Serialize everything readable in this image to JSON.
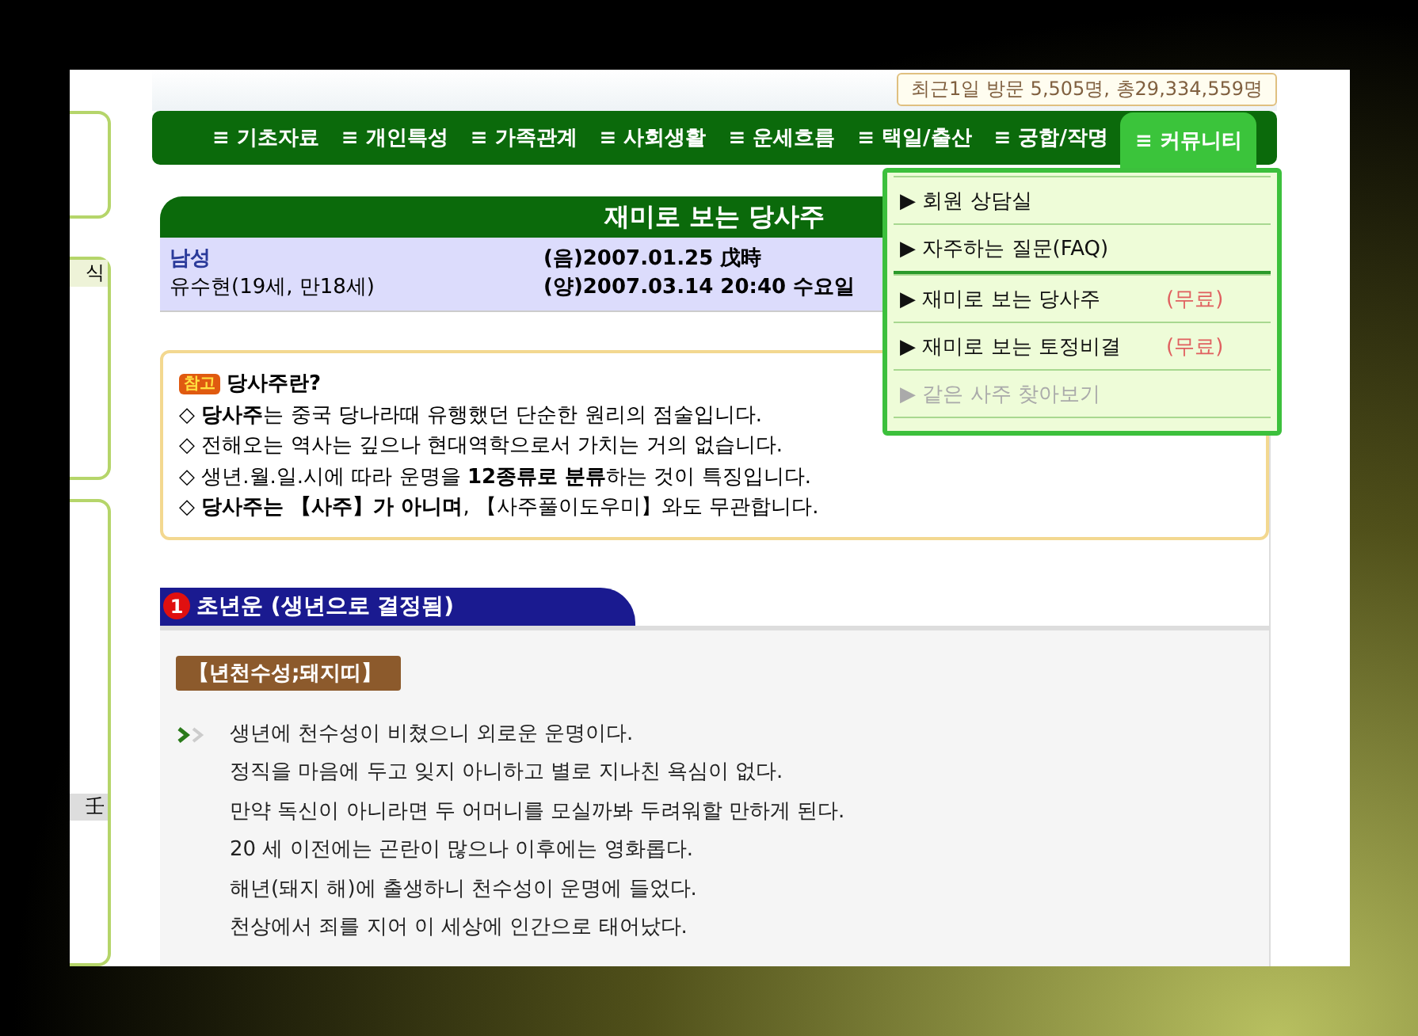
{
  "visitor_counter": "최근1일 방문 5,505명, 총29,334,559명",
  "sidebar": {
    "fragments": [
      "식",
      "壬"
    ]
  },
  "nav": [
    {
      "label": "≡ 기초자료",
      "selected": false
    },
    {
      "label": "≡ 개인특성",
      "selected": false
    },
    {
      "label": "≡ 가족관계",
      "selected": false
    },
    {
      "label": "≡ 사회생활",
      "selected": false
    },
    {
      "label": "≡ 운세흐름",
      "selected": false
    },
    {
      "label": "≡ 택일/출산",
      "selected": false
    },
    {
      "label": "≡ 궁합/작명",
      "selected": false
    },
    {
      "label": "≡ 커뮤니티",
      "selected": true
    }
  ],
  "dropdown": {
    "items": [
      {
        "label": "▶ 회원 상담실",
        "disabled": false,
        "divider_after": false
      },
      {
        "label": "▶ 자주하는 질문(FAQ)",
        "disabled": false,
        "divider_after": true
      },
      {
        "label": "▶ 재미로 보는 당사주",
        "note": "(무료)",
        "disabled": false,
        "divider_after": false
      },
      {
        "label": "▶ 재미로 보는 토정비결",
        "note": "(무료)",
        "disabled": false,
        "divider_after": false
      },
      {
        "label": "▶ 같은 사주 찾아보기",
        "disabled": true,
        "divider_after": false
      }
    ]
  },
  "title": "재미로 보는 당사주",
  "profile": {
    "gender": "남성",
    "name_age": "유수현(19세, 만18세)",
    "lunar": "(음)2007.01.25 戊時",
    "solar": "(양)2007.03.14 20:40 수요일"
  },
  "note": {
    "badge": "참고",
    "heading": "당사주란?",
    "lines": [
      "◇ **당사주**는 중국 당나라때 유행했던 단순한 원리의 점술입니다.",
      "◇ 전해오는 역사는 깊으나 현대역학으로서 가치는 거의 없습니다.",
      "◇ 생년.월.일.시에 따라 운명을 **12종류로 분류**하는 것이 특징입니다.",
      "◇ **당사주는 【사주】가 아니며**, 【사주풀이도우미】와도 무관합니다."
    ]
  },
  "section": {
    "number": "1",
    "title": "초년운 (생년으로 결정됨)",
    "tag": "【년천수성;돼지띠】",
    "lines": [
      "생년에 천수성이 비쳤으니 외로운 운명이다.",
      "정직을 마음에 두고 잊지 아니하고 별로 지나친 욕심이 없다.",
      "만약 독신이 아니라면 두 어머니를 모실까봐 두려워할 만하게 된다.",
      "20 세 이전에는 곤란이 많으나 이후에는 영화롭다.",
      "해년(돼지 해)에 출생하니 천수성이 운명에 들었다.",
      "천상에서 죄를 지어 이 세상에 인간으로 태어났다."
    ]
  }
}
